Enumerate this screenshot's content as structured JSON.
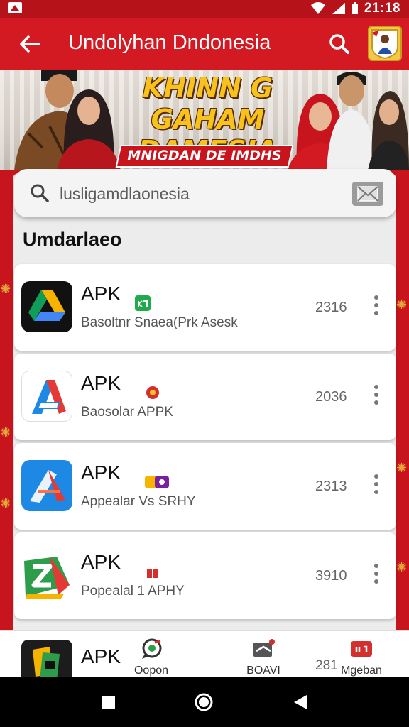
{
  "status_bar": {
    "time": "21:18"
  },
  "app_bar": {
    "title": "Undolyhan Dndonesia"
  },
  "banner": {
    "headline_line1": "KHINN G GAHAM",
    "headline_line2": "DAMESIA",
    "ribbon_text": "MNIGDAN DE IMDHS"
  },
  "search": {
    "placeholder": "lusligamdlaonesia"
  },
  "section": {
    "title": "Umdarlaeo"
  },
  "apps": [
    {
      "title": "APK",
      "subtitle": "Basoltnr Snaea(Prk Asesk",
      "number": "2316"
    },
    {
      "title": "APK",
      "subtitle": "Baosolar APPK",
      "number": "2036"
    },
    {
      "title": "APK",
      "subtitle": "Appealar Vs SRHY",
      "number": "2313"
    },
    {
      "title": "APK",
      "subtitle": "Popealal 1 APHY",
      "number": "3910"
    }
  ],
  "peek_app": {
    "title": "APK",
    "number": "281"
  },
  "bottom_nav": [
    {
      "label": "Oopon"
    },
    {
      "label": "BOAVI"
    },
    {
      "label": "Mgeban"
    }
  ],
  "colors": {
    "primary": "#d31a22",
    "banner_gold": "#f6c21b"
  }
}
